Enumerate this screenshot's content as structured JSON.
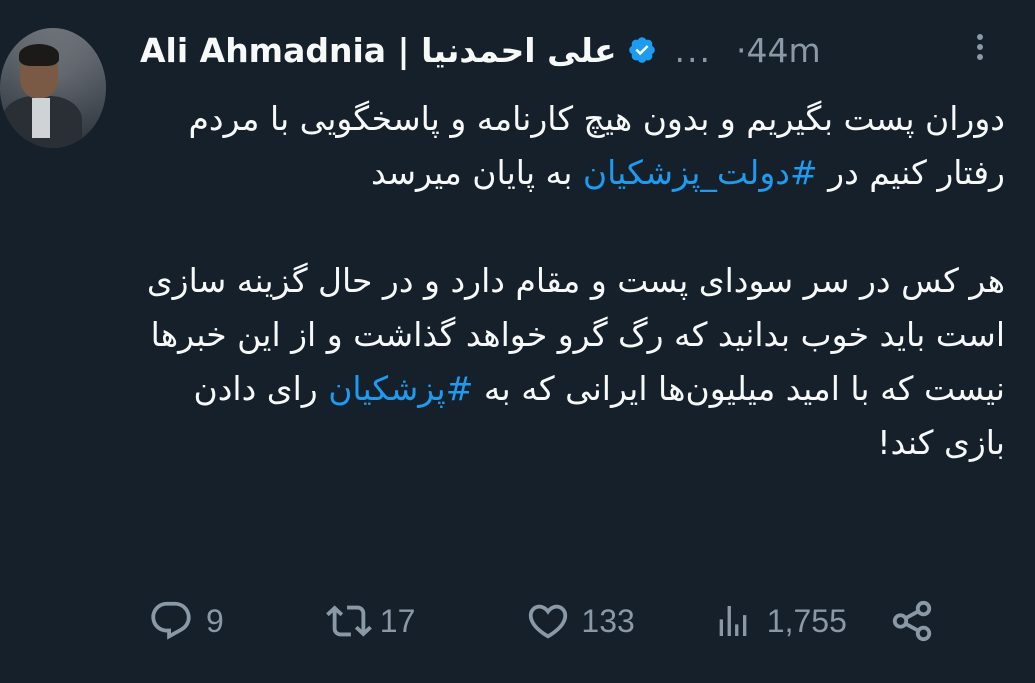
{
  "author": {
    "name": "Ali Ahmadnia | علی احمدنیا",
    "handle": "...",
    "time": "·44m"
  },
  "tweet": {
    "paragraph1": {
      "part1": "دوران پست بگیریم و بدون هیچ کارنامه و پاسخگویی با مردم رفتار کنیم در ",
      "hashtag": "#دولت_پزشکیان",
      "part2": " به پایان میرسد"
    },
    "paragraph2": {
      "part1": "هر کس در سر سودای پست و مقام دارد و در حال گزینه سازی است باید خوب بدانید که رگ گرو خواهد گذاشت و از این خبرها نیست که با امید میلیون‌ها ایرانی که به ",
      "hashtag": "#پزشکیان",
      "part2": " رای دادن بازی کند!"
    }
  },
  "actions": {
    "replies": "9",
    "retweets": "17",
    "likes": "133",
    "views": "1,755"
  },
  "colors": {
    "background": "#15202b",
    "text": "#f7f9f9",
    "muted": "#8b98a5",
    "accent": "#1d9bf0"
  },
  "icons": [
    "verified-badge-icon",
    "more-icon",
    "reply-icon",
    "retweet-icon",
    "like-icon",
    "views-icon",
    "share-icon"
  ]
}
